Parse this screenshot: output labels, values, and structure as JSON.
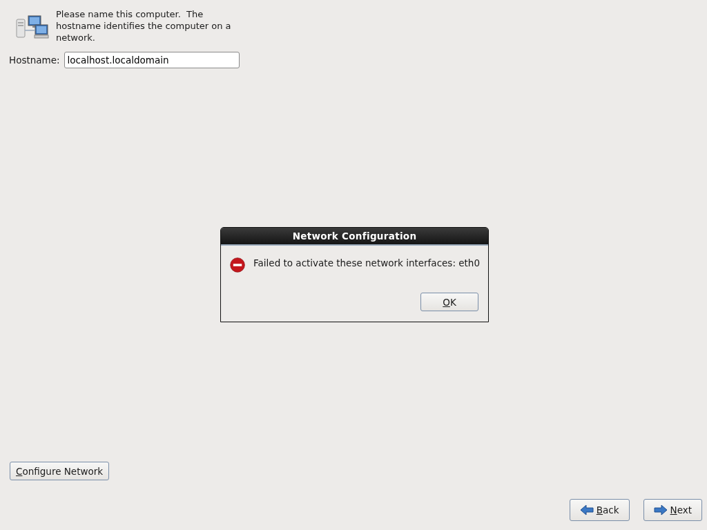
{
  "intro": {
    "text": "Please name this computer.  The hostname identifies the computer on a network."
  },
  "hostname": {
    "label": "Hostname:",
    "value": "localhost.localdomain"
  },
  "configure_button": {
    "label": "Configure Network"
  },
  "nav_buttons": [
    {
      "kind": "back",
      "label": "Back"
    },
    {
      "kind": "next",
      "label": "Next"
    }
  ],
  "dialog": {
    "title": "Network Configuration",
    "message": "Failed to activate these network interfaces: eth0",
    "button": {
      "label": "OK"
    }
  }
}
